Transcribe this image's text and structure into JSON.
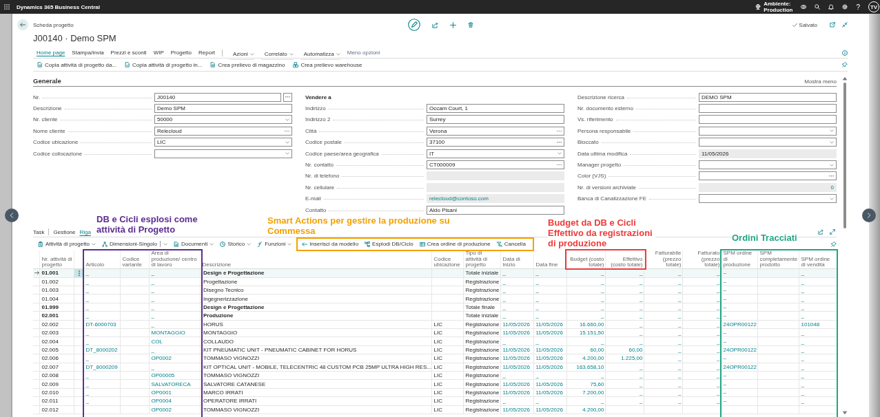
{
  "top_bar": {
    "app_name": "Dynamics 365 Business Central",
    "environment_label": "Ambiente:",
    "environment": "Production",
    "help": "?",
    "avatar": "TV"
  },
  "header": {
    "breadcrumb": "Scheda progetto",
    "title": "J00140 · Demo SPM",
    "save_status": "Salvato"
  },
  "menu": [
    {
      "label": "Home page",
      "kind": "tab",
      "selected": true
    },
    {
      "label": "Stampa/invia",
      "kind": "tab",
      "selected": false
    },
    {
      "label": "Prezzi e sconti",
      "kind": "tab",
      "selected": false
    },
    {
      "label": "WIP",
      "kind": "tab",
      "selected": false
    },
    {
      "label": "Progetto",
      "kind": "tab",
      "selected": false
    },
    {
      "label": "Report",
      "kind": "tab",
      "selected": false
    },
    {
      "label": "Azioni",
      "kind": "menu",
      "selected": false
    },
    {
      "label": "Correlato",
      "kind": "menu",
      "selected": false
    },
    {
      "label": "Automatizza",
      "kind": "menu",
      "selected": false
    },
    {
      "label": "Meno opzioni",
      "kind": "toggle",
      "selected": false
    }
  ],
  "actions": [
    {
      "label": "Copia attività di progetto da...",
      "kind": "import"
    },
    {
      "label": "Copia attività di progetto in...",
      "kind": "export"
    },
    {
      "label": "Crea prelievo di magazzino",
      "kind": "pick"
    },
    {
      "label": "Crea prelievo warehouse",
      "kind": "warehouse"
    }
  ],
  "general": {
    "title": "Generale",
    "toggle": "Mostra meno",
    "columns": [
      [
        {
          "label": "Nr.",
          "value": "J00140",
          "kind": "assist"
        },
        {
          "label": "Descrizione",
          "value": "Demo SPM",
          "kind": "text"
        },
        {
          "label": "Nr. cliente",
          "value": "50000",
          "kind": "dropdown"
        },
        {
          "label": "Nome cliente",
          "value": "Relecloud",
          "kind": "lookup"
        },
        {
          "label": "Codice ubicazione",
          "value": "LIC",
          "kind": "dropdown"
        },
        {
          "label": "Codice collocazione",
          "kind": "dropdown"
        }
      ],
      [
        {
          "label": "Vendere a",
          "kind": "heading"
        },
        {
          "label": "Indirizzo",
          "value": "Occam Court, 1",
          "kind": "text"
        },
        {
          "label": "Indirizzo 2",
          "value": "Surrey",
          "kind": "text"
        },
        {
          "label": "Città",
          "value": "Verona",
          "kind": "lookup"
        },
        {
          "label": "Codice postale",
          "value": "37100",
          "kind": "lookup"
        },
        {
          "label": "Codice paese/area geografica",
          "value": "IT",
          "kind": "dropdown"
        },
        {
          "label": "Nr. contatto",
          "value": "CT000009",
          "kind": "lookup"
        },
        {
          "label": "Nr. di telefono",
          "kind": "readonly"
        },
        {
          "label": "Nr. cellulare",
          "kind": "readonly"
        },
        {
          "label": "E-mail",
          "value": "relecloud@contoso.com",
          "kind": "email"
        },
        {
          "label": "Contatto",
          "value": "Aldo Pisani",
          "kind": "text"
        }
      ],
      [
        {
          "label": "Descrizione ricerca",
          "value": "DEMO SPM",
          "kind": "text"
        },
        {
          "label": "Nr. documento esterno",
          "kind": "text"
        },
        {
          "label": "Vs. riferimento",
          "kind": "text"
        },
        {
          "label": "Persona responsabile",
          "kind": "dropdown"
        },
        {
          "label": "Bloccato",
          "kind": "dropdown"
        },
        {
          "label": "Data ultima modifica",
          "value": "11/05/2026",
          "kind": "readonly"
        },
        {
          "label": "Manager progetto",
          "kind": "dropdown"
        },
        {
          "label": "Color (VJS)",
          "kind": "lookup"
        },
        {
          "label": "Nr. di versioni archiviate",
          "value": "0",
          "kind": "count"
        },
        {
          "label": "Banca di Canalizzazione FE",
          "kind": "dropdown"
        }
      ]
    ]
  },
  "lines": {
    "title": "Task",
    "tabs": [
      {
        "label": "Gestione",
        "selected": false
      },
      {
        "label": "Riga",
        "selected": true
      }
    ],
    "toolbar": [
      {
        "label": "Attività di progetto",
        "kind": "tasks",
        "dropdown": true,
        "split": false
      },
      {
        "label": "Dimensioni-Singolo",
        "kind": "dimensions",
        "dropdown": true,
        "split": true
      },
      {
        "label": "Documenti",
        "kind": "documents",
        "dropdown": true,
        "split": false
      },
      {
        "label": "Storico",
        "kind": "history",
        "dropdown": true,
        "split": false
      },
      {
        "label": "Funzioni",
        "kind": "functions",
        "dropdown": true,
        "split": false
      },
      {
        "label": "Inserisci da modello",
        "kind": "insert",
        "dropdown": false,
        "split": false
      },
      {
        "label": "Esplodi DB/Ciclo",
        "kind": "explode",
        "dropdown": false,
        "split": false
      },
      {
        "label": "Crea ordine di produzione",
        "kind": "order",
        "dropdown": false,
        "split": false
      },
      {
        "label": "Cancella",
        "kind": "clear",
        "dropdown": false,
        "split": false
      }
    ],
    "columns": [
      {
        "label": "Nr. attività di progetto",
        "kind": "key"
      },
      {
        "label": "Articolo",
        "kind": "link"
      },
      {
        "label": "Codice variante",
        "kind": "link"
      },
      {
        "label": "Area di produzione/ centro di lavoro",
        "kind": "link"
      },
      {
        "label": "Descrizione",
        "kind": "description"
      },
      {
        "label": "Codice ubicazione",
        "kind": "text"
      },
      {
        "label": "Tipo di attività di progetto",
        "kind": "text"
      },
      {
        "label": "Data di inizio",
        "kind": "link"
      },
      {
        "label": "Data fine",
        "kind": "link"
      },
      {
        "label": "Budget (costo totale)",
        "kind": "amount"
      },
      {
        "label": "Effettivo (costo totale)",
        "kind": "amount"
      },
      {
        "label": "Fatturabile (prezzo totale)",
        "kind": "amount"
      },
      {
        "label": "Fatturato (prezzo totale)",
        "kind": "amount"
      },
      {
        "label": "SPM ordine di produzione",
        "kind": "link"
      },
      {
        "label": "SPM completamente prodotto",
        "kind": "text"
      },
      {
        "label": "SPM ordine di vendita",
        "kind": "link"
      }
    ],
    "rows": [
      {
        "kind": "total",
        "selected": true,
        "cells": [
          "01.001",
          "_",
          null,
          "_",
          "Design e Progettazione",
          null,
          "Totale iniziale",
          "_",
          "_",
          "_",
          "_",
          "_",
          "_",
          "–",
          null,
          "_"
        ]
      },
      {
        "kind": "posting",
        "selected": false,
        "cells": [
          "01.002",
          "_",
          null,
          "_",
          "Progettazione",
          null,
          "Registrazione",
          "_",
          "_",
          "_",
          "_",
          "_",
          "_",
          "–",
          null,
          "_"
        ]
      },
      {
        "kind": "posting",
        "selected": false,
        "cells": [
          "01.003",
          "_",
          null,
          "_",
          "Disegno Tecnico",
          null,
          "Registrazione",
          "_",
          "_",
          "_",
          "_",
          "_",
          "_",
          "–",
          null,
          "_"
        ]
      },
      {
        "kind": "posting",
        "selected": false,
        "cells": [
          "01.004",
          "_",
          null,
          "_",
          "Ingegnerizzazione",
          null,
          "Registrazione",
          "_",
          "_",
          "_",
          "_",
          "_",
          "_",
          "–",
          null,
          "_"
        ]
      },
      {
        "kind": "total",
        "selected": false,
        "cells": [
          "01.999",
          "_",
          null,
          "_",
          "Design e Progettazione",
          null,
          "Totale finale",
          "_",
          "_",
          "_",
          "_",
          "_",
          "_",
          "–",
          null,
          "_"
        ]
      },
      {
        "kind": "total",
        "selected": false,
        "cells": [
          "02.001",
          "_",
          null,
          "_",
          "Produzione",
          null,
          "Totale iniziale",
          "_",
          "_",
          "_",
          "_",
          "_",
          "_",
          "–",
          null,
          "_"
        ]
      },
      {
        "kind": "posting",
        "selected": false,
        "cells": [
          "02.002",
          "DT-6000703",
          null,
          "_",
          "HORUS",
          "LIC",
          "Registrazione",
          "11/05/2026",
          "11/05/2026",
          "16.660,00",
          "_",
          "_",
          "_",
          "24OPR00122",
          null,
          "101048"
        ]
      },
      {
        "kind": "posting",
        "selected": false,
        "cells": [
          "02.003",
          "_",
          null,
          "MONTAGGIO",
          "MONTAGGIO",
          "LIC",
          "Registrazione",
          "11/05/2026",
          "11/05/2026",
          "15.151,50",
          "_",
          "_",
          "_",
          "–",
          null,
          "_"
        ]
      },
      {
        "kind": "posting",
        "selected": false,
        "cells": [
          "02.004",
          "_",
          null,
          "COL",
          "COLLAUDO",
          "LIC",
          "Registrazione",
          "_",
          "_",
          "_",
          "_",
          "_",
          "_",
          "–",
          null,
          "_"
        ]
      },
      {
        "kind": "posting",
        "selected": false,
        "cells": [
          "02.005",
          "DT_8000202",
          null,
          "_",
          "KIT PNEUMATIC UNIT - PNEUMATIC CABINET FOR HORUS",
          "LIC",
          "Registrazione",
          "11/05/2026",
          "11/05/2026",
          "60,00",
          "60,00",
          "_",
          "_",
          "24OPR00122",
          null,
          "_"
        ]
      },
      {
        "kind": "posting",
        "selected": false,
        "cells": [
          "02.006",
          "_",
          null,
          "OP0002",
          "TOMMASO VIGNOZZI",
          "LIC",
          "Registrazione",
          "11/05/2026",
          "11/05/2026",
          "4.200,00",
          "1.225,00",
          "_",
          "_",
          "–",
          null,
          "_"
        ]
      },
      {
        "kind": "posting",
        "selected": false,
        "cells": [
          "02.007",
          "DT_8000209",
          null,
          "_",
          "KIT OPTICAL UNIT - MOBILE, TELECENTRIC 48 CUSTOM PCB 25MP ULTRA HIGH RES...",
          "LIC",
          "Registrazione",
          "11/05/2026",
          "11/05/2026",
          "163.658,10",
          "_",
          "_",
          "_",
          "24OPR00122",
          null,
          "_"
        ]
      },
      {
        "kind": "posting",
        "selected": false,
        "cells": [
          "02.008",
          "_",
          null,
          "OP00005",
          "TOMMASO VIGNOZZI",
          "LIC",
          "Registrazione",
          "_",
          "_",
          "_",
          "_",
          "_",
          "_",
          "–",
          null,
          "_"
        ]
      },
      {
        "kind": "posting",
        "selected": false,
        "cells": [
          "02.009",
          "_",
          null,
          "SALVATORECA",
          "SALVATORE CATANESE",
          "LIC",
          "Registrazione",
          "11/05/2026",
          "11/05/2026",
          "75,60",
          "_",
          "_",
          "_",
          "–",
          null,
          "_"
        ]
      },
      {
        "kind": "posting",
        "selected": false,
        "cells": [
          "02.010",
          "_",
          null,
          "OP0001",
          "MARCO IRRATI",
          "LIC",
          "Registrazione",
          "11/05/2026",
          "11/05/2026",
          "7.200,00",
          "_",
          "_",
          "_",
          "–",
          null,
          "_"
        ]
      },
      {
        "kind": "posting",
        "selected": false,
        "cells": [
          "02.011",
          "_",
          null,
          "OP0004",
          "OPERATORE IRRATI",
          "LIC",
          "Registrazione",
          "_",
          "_",
          "_",
          "_",
          "_",
          "_",
          "–",
          null,
          "_"
        ]
      },
      {
        "kind": "posting",
        "selected": false,
        "cells": [
          "02.012",
          null,
          null,
          "OP0002",
          "TOMMASO VIGNOZZI",
          "LIC",
          "Registrazione",
          "11/05/2026",
          "11/05/2026",
          "4.200,00",
          null,
          null,
          null,
          null,
          null,
          null
        ]
      }
    ]
  },
  "annotations": [
    {
      "text": "DB e Cicli esplosi come attività di Progetto",
      "color": "#5c2d91"
    },
    {
      "text": "Smart Actions per gestire la produzione su Commessa",
      "color": "#f2a100"
    },
    {
      "text": "Budget da DB e Cicli Effettivo da registrazioni di produzione",
      "color": "#ee3b3b"
    },
    {
      "text": "Ordini Tracciati",
      "color": "#1fa583"
    }
  ]
}
